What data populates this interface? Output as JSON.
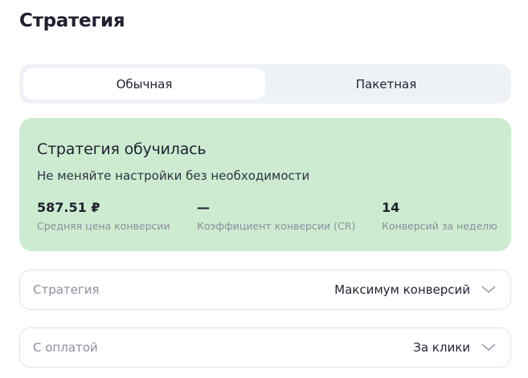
{
  "title": "Стратегия",
  "tabs": [
    {
      "label": "Обычная",
      "active": true
    },
    {
      "label": "Пакетная",
      "active": false
    }
  ],
  "status_card": {
    "heading": "Стратегия обучилась",
    "subtitle": "Не меняйте настройки без необходимости",
    "bg_color": "#cdebd0",
    "stats": [
      {
        "value": "587.51 ₽",
        "label": "Средняя цена конверсии"
      },
      {
        "value": "—",
        "label": "Коэффициент конверсии (CR)"
      },
      {
        "value": "14",
        "label": "Конверсий за неделю"
      }
    ]
  },
  "fields": [
    {
      "label": "Стратегия",
      "value": "Максимум конверсий",
      "icon": "chevron-down-icon"
    },
    {
      "label": "С оплатой",
      "value": "За клики",
      "icon": "chevron-down-icon"
    }
  ]
}
